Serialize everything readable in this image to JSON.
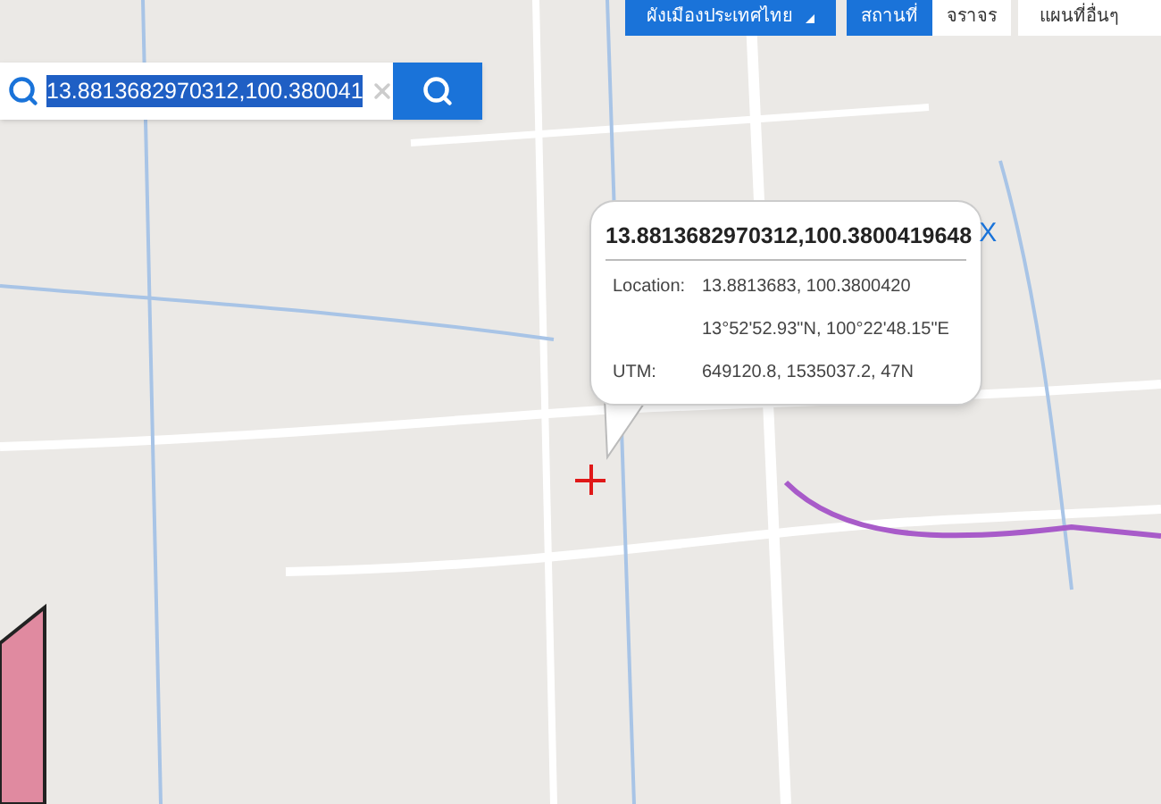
{
  "layer_menu": {
    "label": "ผังเมืองประเทศไทย"
  },
  "tabs": [
    {
      "label": "สถานที่",
      "selected": true
    },
    {
      "label": "จราจร",
      "selected": false
    }
  ],
  "other_maps_menu": {
    "label": "แผนที่อื่นๆ"
  },
  "search": {
    "value": "13.8813682970312,100.380041",
    "selected": true
  },
  "popup": {
    "title": "13.8813682970312,100.3800419648",
    "close": "X",
    "rows": [
      {
        "label": "Location:",
        "value": "13.8813683, 100.3800420"
      },
      {
        "label": "",
        "value": "13°52'52.93\"N, 100°22'48.15\"E"
      },
      {
        "label": "UTM:",
        "value": "649120.8, 1535037.2, 47N"
      }
    ]
  }
}
